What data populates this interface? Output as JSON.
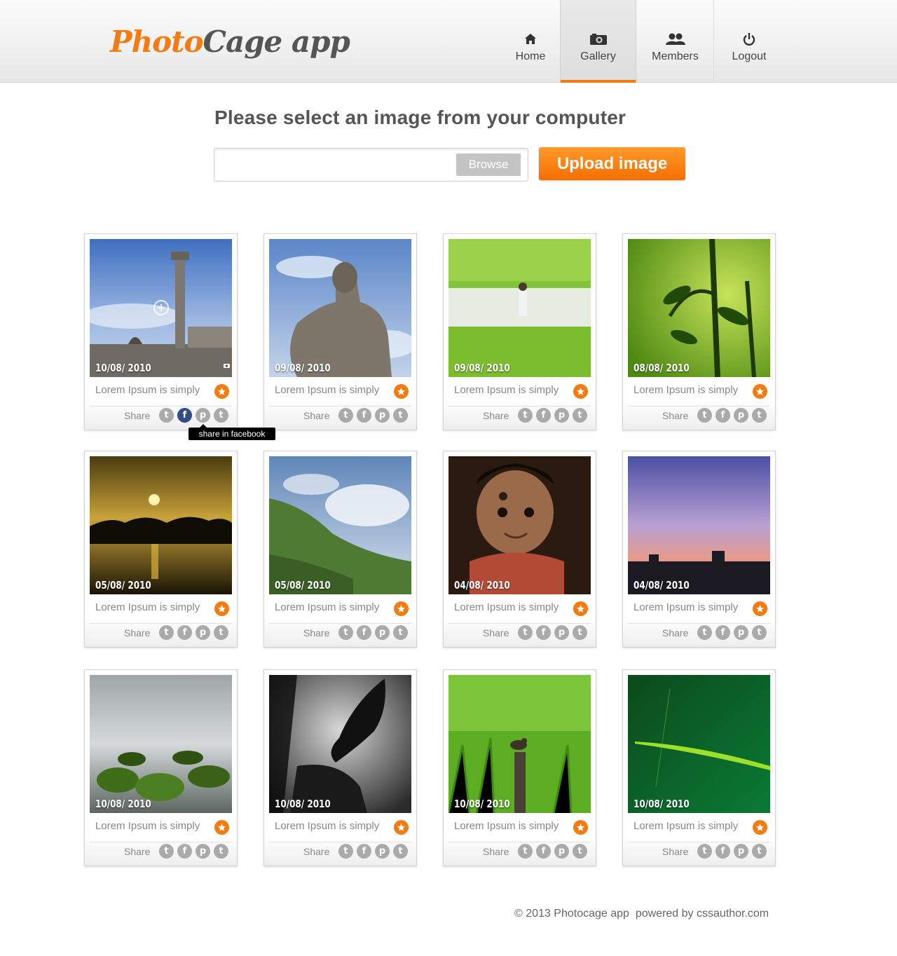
{
  "header": {
    "logo_part1": "Photo",
    "logo_part2": "Cage app",
    "nav": [
      {
        "label": "Home",
        "icon": "home-icon"
      },
      {
        "label": "Gallery",
        "icon": "camera-icon",
        "active": true
      },
      {
        "label": "Members",
        "icon": "members-icon"
      },
      {
        "label": "Logout",
        "icon": "power-icon"
      }
    ]
  },
  "upload": {
    "title": "Please select an image from your computer",
    "file_value": "",
    "browse_label": "Browse",
    "upload_label": "Upload image"
  },
  "gallery": {
    "caption": "Lorem Ipsum is simply",
    "share_label": "Share",
    "share_icons": [
      "twitter-icon",
      "facebook-icon",
      "pinterest-icon",
      "tumblr-icon"
    ],
    "tooltip": "share in facebook",
    "items": [
      {
        "date": "10/08/ 2010"
      },
      {
        "date": "09/08/ 2010"
      },
      {
        "date": "09/08/ 2010"
      },
      {
        "date": "08/08/ 2010"
      },
      {
        "date": "05/08/ 2010"
      },
      {
        "date": "05/08/ 2010"
      },
      {
        "date": "04/08/ 2010"
      },
      {
        "date": "04/08/ 2010"
      },
      {
        "date": "10/08/ 2010"
      },
      {
        "date": "10/08/ 2010"
      },
      {
        "date": "10/08/ 2010"
      },
      {
        "date": "10/08/ 2010"
      }
    ]
  },
  "footer": {
    "text": "© 2013 Photocage app  powered by cssauthor.com"
  },
  "colors": {
    "accent": "#f47b12",
    "facebook_active": "#2f4c8c",
    "share_icon": "#aaaaaa"
  }
}
